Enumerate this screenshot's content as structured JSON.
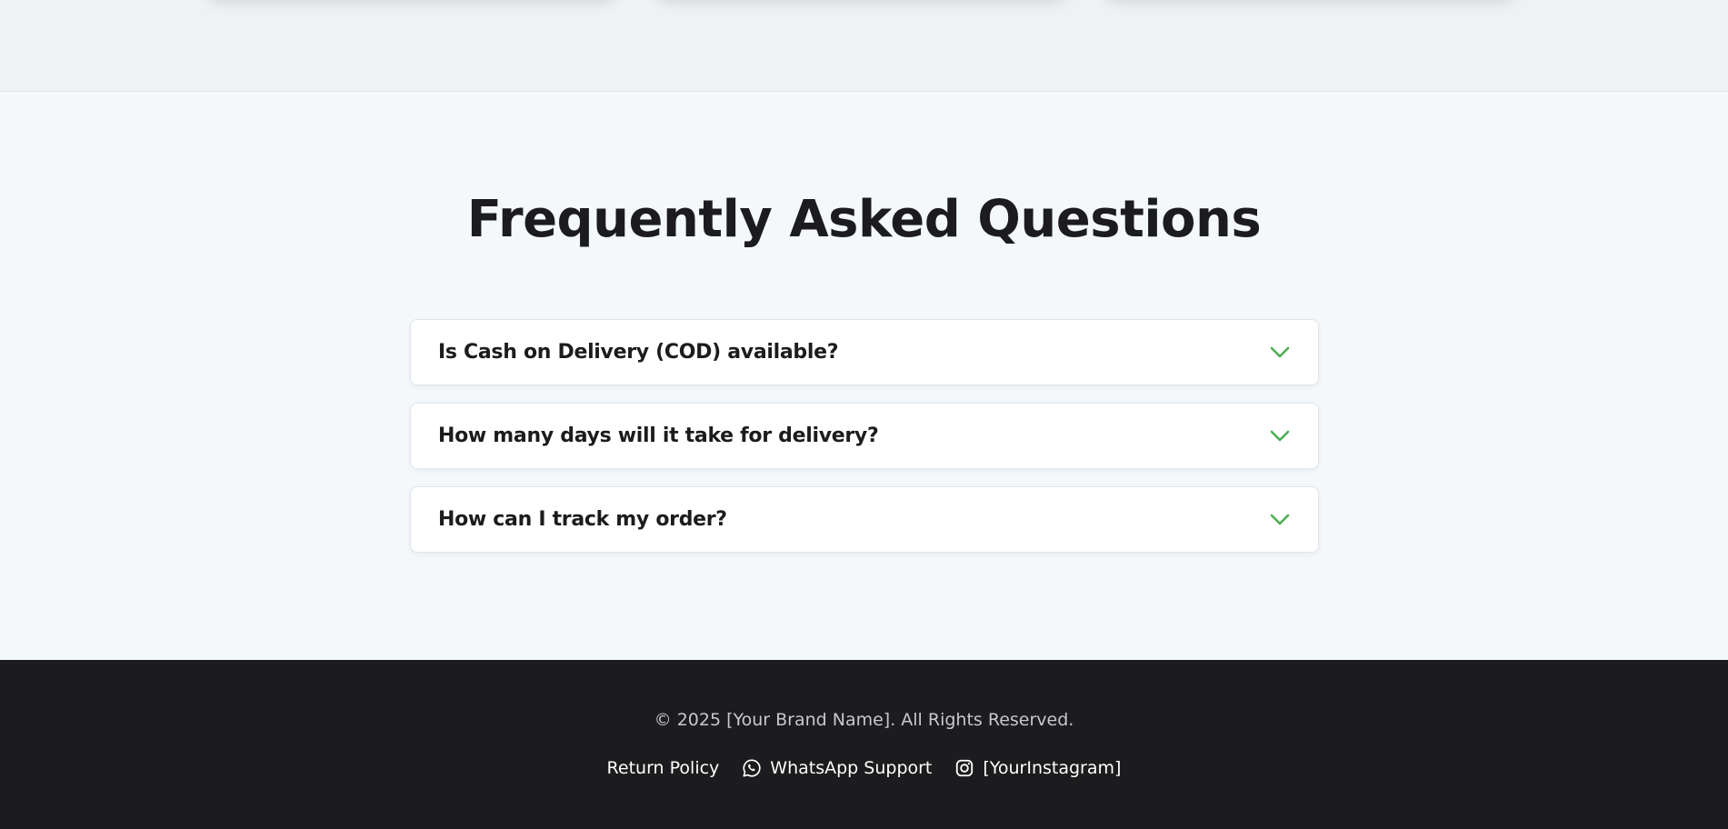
{
  "faq": {
    "title": "Frequently Asked Questions",
    "items": [
      {
        "question": "Is Cash on Delivery (COD) available?",
        "icon": "chevron-down-icon"
      },
      {
        "question": "How many days will it take for delivery?",
        "icon": "chevron-down-icon"
      },
      {
        "question": "How can I track my order?",
        "icon": "chevron-down-icon"
      }
    ],
    "accent_color": "#4caf50"
  },
  "footer": {
    "copyright": "© 2025 [Your Brand Name]. All Rights Reserved.",
    "links": [
      {
        "label": "Return Policy"
      },
      {
        "label": "WhatsApp Support",
        "icon": "whatsapp-icon"
      },
      {
        "label": "[YourInstagram]",
        "icon": "instagram-icon"
      }
    ],
    "background": "#1c1c1e"
  }
}
